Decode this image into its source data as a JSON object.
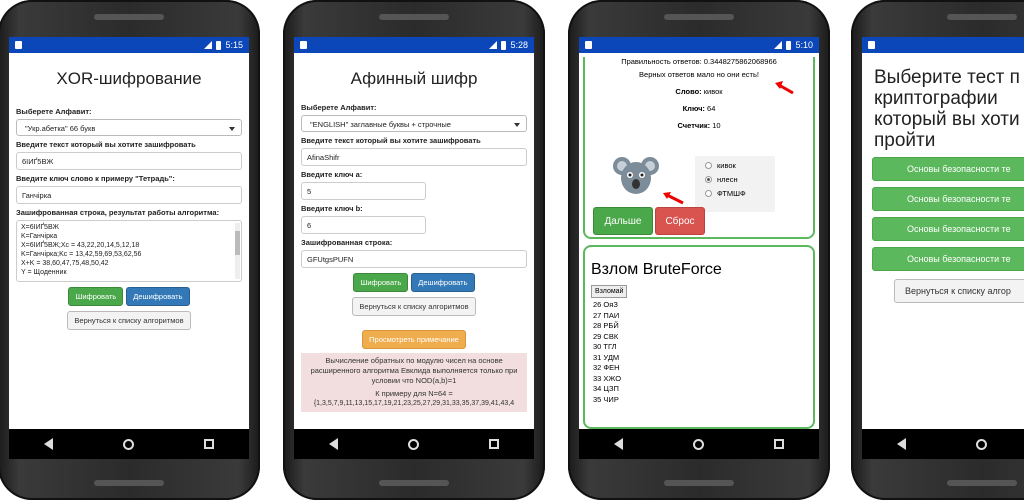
{
  "status": {
    "time1": "5:15",
    "time2": "5:28",
    "time3": "5:10"
  },
  "xor": {
    "title": "XOR-шифрование",
    "alphabet_label": "Выберете Алфавит:",
    "alphabet_value": "\"Укр.абетка\" 66 букв",
    "text_label": "Введите текст который вы хотите зашифровать",
    "text_value": "6ІИҐ5ВЖ",
    "key_label": "Введите ключ слово к примеру \"Тетрадь\":",
    "key_value": "Ганчірка",
    "result_label": "Зашифрованная строка, результат работы алгоритма:",
    "result_lines": [
      "X=6ІИҐ5ВЖ",
      "K=Ганчірка",
      "X=6ІИҐ5ВЖ;Xc = 43,22,20,14,5,12,18",
      "K=Ганчірка;Kc = 13,42,59,69,53,62,56",
      "X+K = 38,60,47,75,48,50,42",
      "Y = Щоденник"
    ],
    "encrypt_btn": "Шифровать",
    "decrypt_btn": "Дешифровать",
    "back_btn": "Вернуться к списку алгоритмов"
  },
  "affine": {
    "title": "Афинный шифр",
    "alphabet_label": "Выберете Алфавит:",
    "alphabet_value": "\"ENGLISH\" заглавные буквы + строчные",
    "text_label": "Введите текст который вы хотите зашифровать",
    "text_value": "AfinaShifr",
    "a_label": "Введите ключ a:",
    "a_value": "5",
    "b_label": "Введите ключ b:",
    "b_value": "6",
    "result_label": "Зашифрованная строка:",
    "result_value": "GFUtgsPUFN",
    "encrypt_btn": "Шифровать",
    "decrypt_btn": "Дешифровать",
    "back_btn": "Вернуться к списку алгоритмов",
    "note_btn": "Просмотреть примечание",
    "note_text1": "Вычисление обратных по модулю чисел на основе расширенного алгоритма Евклида выполняется только при условии что NOD(a,b)=1",
    "note_text2": "К примеру для N=64 =",
    "note_text3": "{1,3,5,7,9,11,13,15,17,19,21,23,25,27,29,31,33,35,37,39,41,43,4"
  },
  "quiz": {
    "accuracy": "Правильность ответов: 0.3448275862068966",
    "few": "Верных ответов мало но они есть!",
    "word_label": "Слово:",
    "word_value": "кивок",
    "key_label": "Ключ:",
    "key_value": "64",
    "counter_label": "Счетчик:",
    "counter_value": "10",
    "options": [
      "кивок",
      "нлесн",
      "ФТМШФ"
    ],
    "next_btn": "Дальше",
    "reset_btn": "Сброс",
    "bf_title": "Взлом BruteForce",
    "bf_btn": "Взломай",
    "bf_items": [
      "26 ОяЗ",
      "27 ПАИ",
      "28 РБЙ",
      "29 СВК",
      "30 ТГЛ",
      "31 УДМ",
      "32 ФЕН",
      "33 ХЖО",
      "34 ЦЗП",
      "35 ЧИР"
    ]
  },
  "tests": {
    "title_lines": [
      "Выберите тест п",
      "криптографии",
      "который вы хоти",
      "пройти"
    ],
    "buttons": [
      "Основы безопасности те",
      "Основы безопасности те",
      "Основы безопасности те",
      "Основы безопасности те"
    ],
    "back": "Вернуться к списку алгор"
  }
}
